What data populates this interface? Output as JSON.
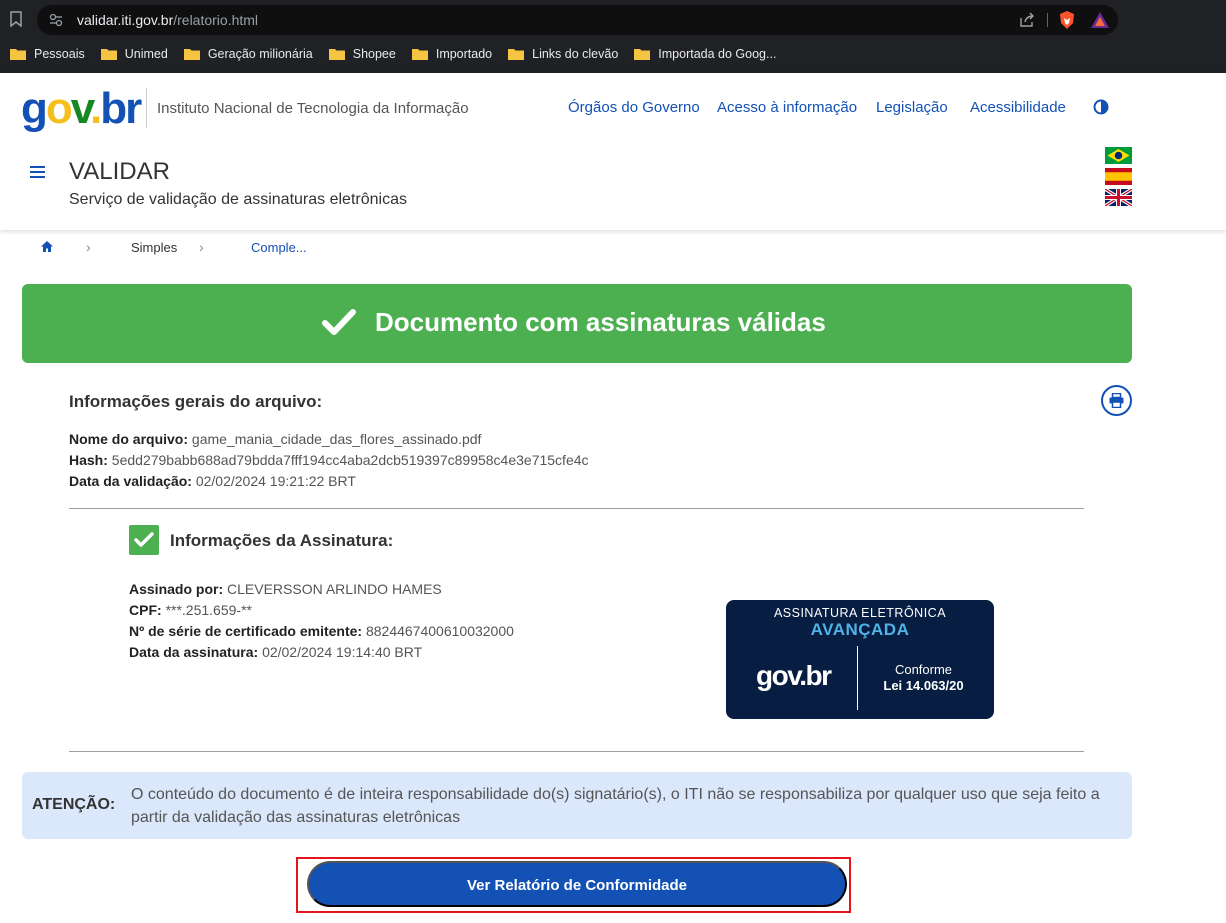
{
  "browser": {
    "url_host": "validar.iti.gov.br",
    "url_path": "/relatorio.html",
    "bookmarks": [
      "Pessoais",
      "Unimed",
      "Geração milionária",
      "Shopee",
      "Importado",
      "Links do clevão",
      "Importada do Goog..."
    ]
  },
  "header": {
    "logo": {
      "g": "g",
      "o": "o",
      "v": "v",
      "dot": ".",
      "b": "b",
      "r": "r"
    },
    "org_name": "Instituto Nacional de Tecnologia da Informação",
    "links": [
      "Órgãos do Governo",
      "Acesso à informação",
      "Legislação",
      "Acessibilidade"
    ],
    "title": "VALIDAR",
    "subtitle": "Serviço de validação de assinaturas eletrônicas"
  },
  "breadcrumb": {
    "items": [
      "Simples",
      "Comple..."
    ]
  },
  "banner": {
    "text": "Documento com assinaturas válidas",
    "color": "#4caf50"
  },
  "file_info": {
    "title": "Informações gerais do arquivo:",
    "name_label": "Nome do arquivo:",
    "name_value": "game_mania_cidade_das_flores_assinado.pdf",
    "hash_label": "Hash:",
    "hash_value": "5edd279babb688ad79bdda7fff194cc4aba2dcb519397c89958c4e3e715cfe4c",
    "date_label": "Data da validação:",
    "date_value": "02/02/2024 19:21:22 BRT"
  },
  "signature": {
    "title": "Informações da Assinatura:",
    "signer_label": "Assinado por:",
    "signer_value": "CLEVERSSON ARLINDO HAMES",
    "cpf_label": "CPF:",
    "cpf_value": "***.251.659-**",
    "serial_label": "Nº de série de certificado emitente:",
    "serial_value": "8824467400610032000",
    "date_label": "Data da assinatura:",
    "date_value": "02/02/2024 19:14:40 BRT"
  },
  "seal": {
    "top": "ASSINATURA ELETRÔNICA",
    "level": "AVANÇADA",
    "logo": "gov.br",
    "conforme": "Conforme",
    "lei": "Lei 14.063/20"
  },
  "attention": {
    "label": "ATENÇÃO:",
    "text": "O conteúdo do documento é de inteira responsabilidade do(s) signatário(s), o ITI não se responsabiliza por qualquer uso que seja feito a partir da validação das assinaturas eletrônicas"
  },
  "report_button": {
    "label": "Ver Relatório de Conformidade"
  },
  "colors": {
    "primary": "#1351b4",
    "success": "#4caf50",
    "highlight": "#e4141b"
  }
}
